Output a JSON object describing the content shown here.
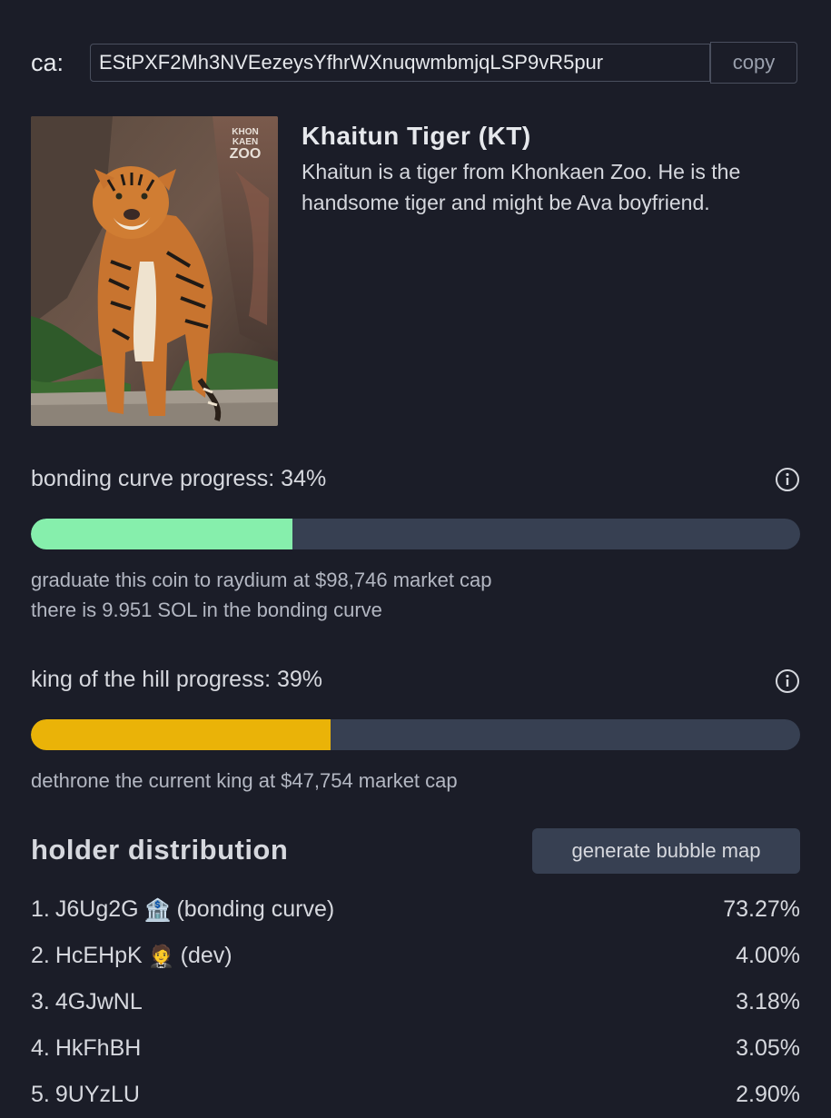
{
  "contract": {
    "label": "ca:",
    "address": "EStPXF2Mh3NVEezeysYfhrWXnuqwmbmjqLSP9vR5pur",
    "copy_label": "copy"
  },
  "coin": {
    "image_watermark": [
      "KHON",
      "KAEN",
      "ZOO"
    ],
    "name": "Khaitun Tiger (KT)",
    "description": "Khaitun is a tiger from Khonkaen Zoo. He is the handsome tiger and might be Ava boyfriend."
  },
  "bonding_curve": {
    "label": "bonding curve progress: 34%",
    "progress": 0.34,
    "note_line1": "graduate this coin to raydium at $98,746 market cap",
    "note_line2": "there is 9.951 SOL in the bonding curve",
    "color": "#86efac"
  },
  "king_of_hill": {
    "label": "king of the hill progress: 39%",
    "progress": 0.39,
    "note": "dethrone the current king at $47,754 market cap",
    "color": "#eab308"
  },
  "holders": {
    "title": "holder distribution",
    "bubble_button": "generate bubble map",
    "list": [
      {
        "rank": "1.",
        "address": "J6Ug2G",
        "icon": "🏦",
        "tag": "(bonding curve)",
        "percent": "73.27%"
      },
      {
        "rank": "2.",
        "address": "HcEHpK",
        "icon": "🤵",
        "tag": "(dev)",
        "percent": "4.00%"
      },
      {
        "rank": "3.",
        "address": "4GJwNL",
        "icon": "",
        "tag": "",
        "percent": "3.18%"
      },
      {
        "rank": "4.",
        "address": "HkFhBH",
        "icon": "",
        "tag": "",
        "percent": "3.05%"
      },
      {
        "rank": "5.",
        "address": "9UYzLU",
        "icon": "",
        "tag": "",
        "percent": "2.90%"
      }
    ]
  }
}
